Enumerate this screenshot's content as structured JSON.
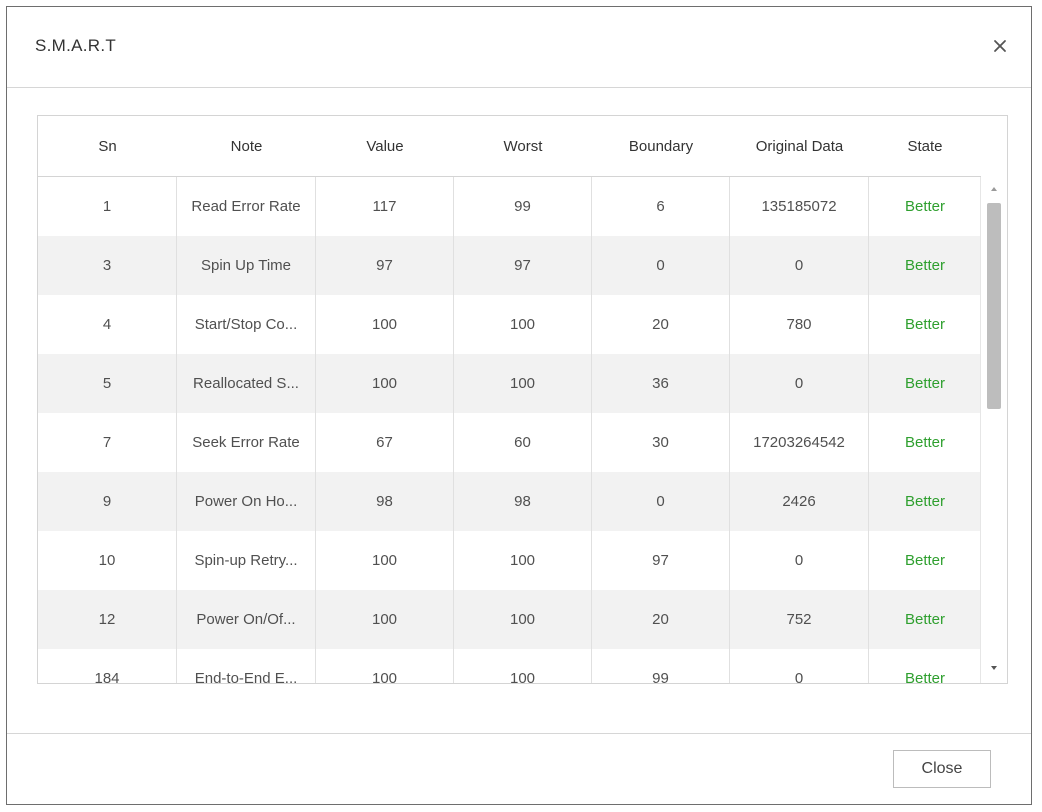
{
  "dialog": {
    "title": "S.M.A.R.T",
    "close_icon": "close-icon"
  },
  "table": {
    "columns": [
      "Sn",
      "Note",
      "Value",
      "Worst",
      "Boundary",
      "Original Data",
      "State"
    ],
    "rows": [
      [
        "1",
        "Read Error Rate",
        "117",
        "99",
        "6",
        "135185072",
        "Better"
      ],
      [
        "3",
        "Spin Up Time",
        "97",
        "97",
        "0",
        "0",
        "Better"
      ],
      [
        "4",
        "Start/Stop Co...",
        "100",
        "100",
        "20",
        "780",
        "Better"
      ],
      [
        "5",
        "Reallocated S...",
        "100",
        "100",
        "36",
        "0",
        "Better"
      ],
      [
        "7",
        "Seek Error Rate",
        "67",
        "60",
        "30",
        "17203264542",
        "Better"
      ],
      [
        "9",
        "Power On Ho...",
        "98",
        "98",
        "0",
        "2426",
        "Better"
      ],
      [
        "10",
        "Spin-up Retry...",
        "100",
        "100",
        "97",
        "0",
        "Better"
      ],
      [
        "12",
        "Power On/Of...",
        "100",
        "100",
        "20",
        "752",
        "Better"
      ],
      [
        "184",
        "End-to-End E...",
        "100",
        "100",
        "99",
        "0",
        "Better"
      ]
    ]
  },
  "footer": {
    "close_label": "Close"
  },
  "colors": {
    "state_good": "#2e9f2e",
    "row_alt": "#f2f2f2"
  }
}
